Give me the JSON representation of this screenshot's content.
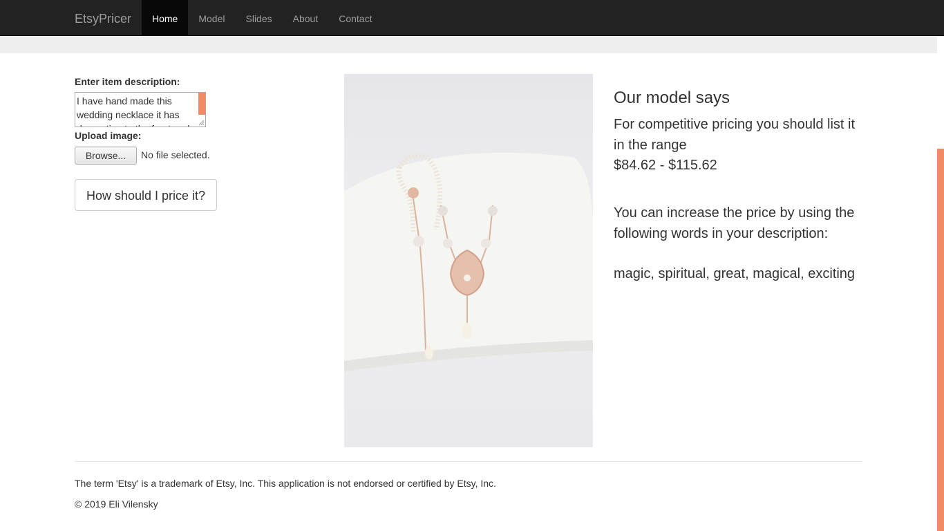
{
  "navbar": {
    "brand": "EtsyPricer",
    "items": [
      {
        "label": "Home",
        "active": true
      },
      {
        "label": "Model"
      },
      {
        "label": "Slides"
      },
      {
        "label": "About"
      },
      {
        "label": "Contact"
      }
    ]
  },
  "form": {
    "description_label": "Enter item description:",
    "description_value": "I have hand made this wedding necklace it has decoration to the front and",
    "upload_label": "Upload image:",
    "browse_label": "Browse...",
    "file_status": "No file selected.",
    "submit_label": "How should I price it?"
  },
  "result": {
    "title": "Our model says",
    "pricing_text": "For competitive pricing you should list it in the range",
    "price_range": "$84.62 - $115.62",
    "increase_text": "You can increase the price by using the following words in your description:",
    "words": "magic, spiritual, great, magical, exciting"
  },
  "footer": {
    "disclaimer": "The term 'Etsy' is a trademark of Etsy, Inc. This application is not endorsed or certified by Etsy, Inc.",
    "copyright": "© 2019 Eli Vilensky"
  },
  "colors": {
    "navbar_bg": "#222222",
    "active_tab_bg": "#080808",
    "accent": "#ef8c66"
  }
}
